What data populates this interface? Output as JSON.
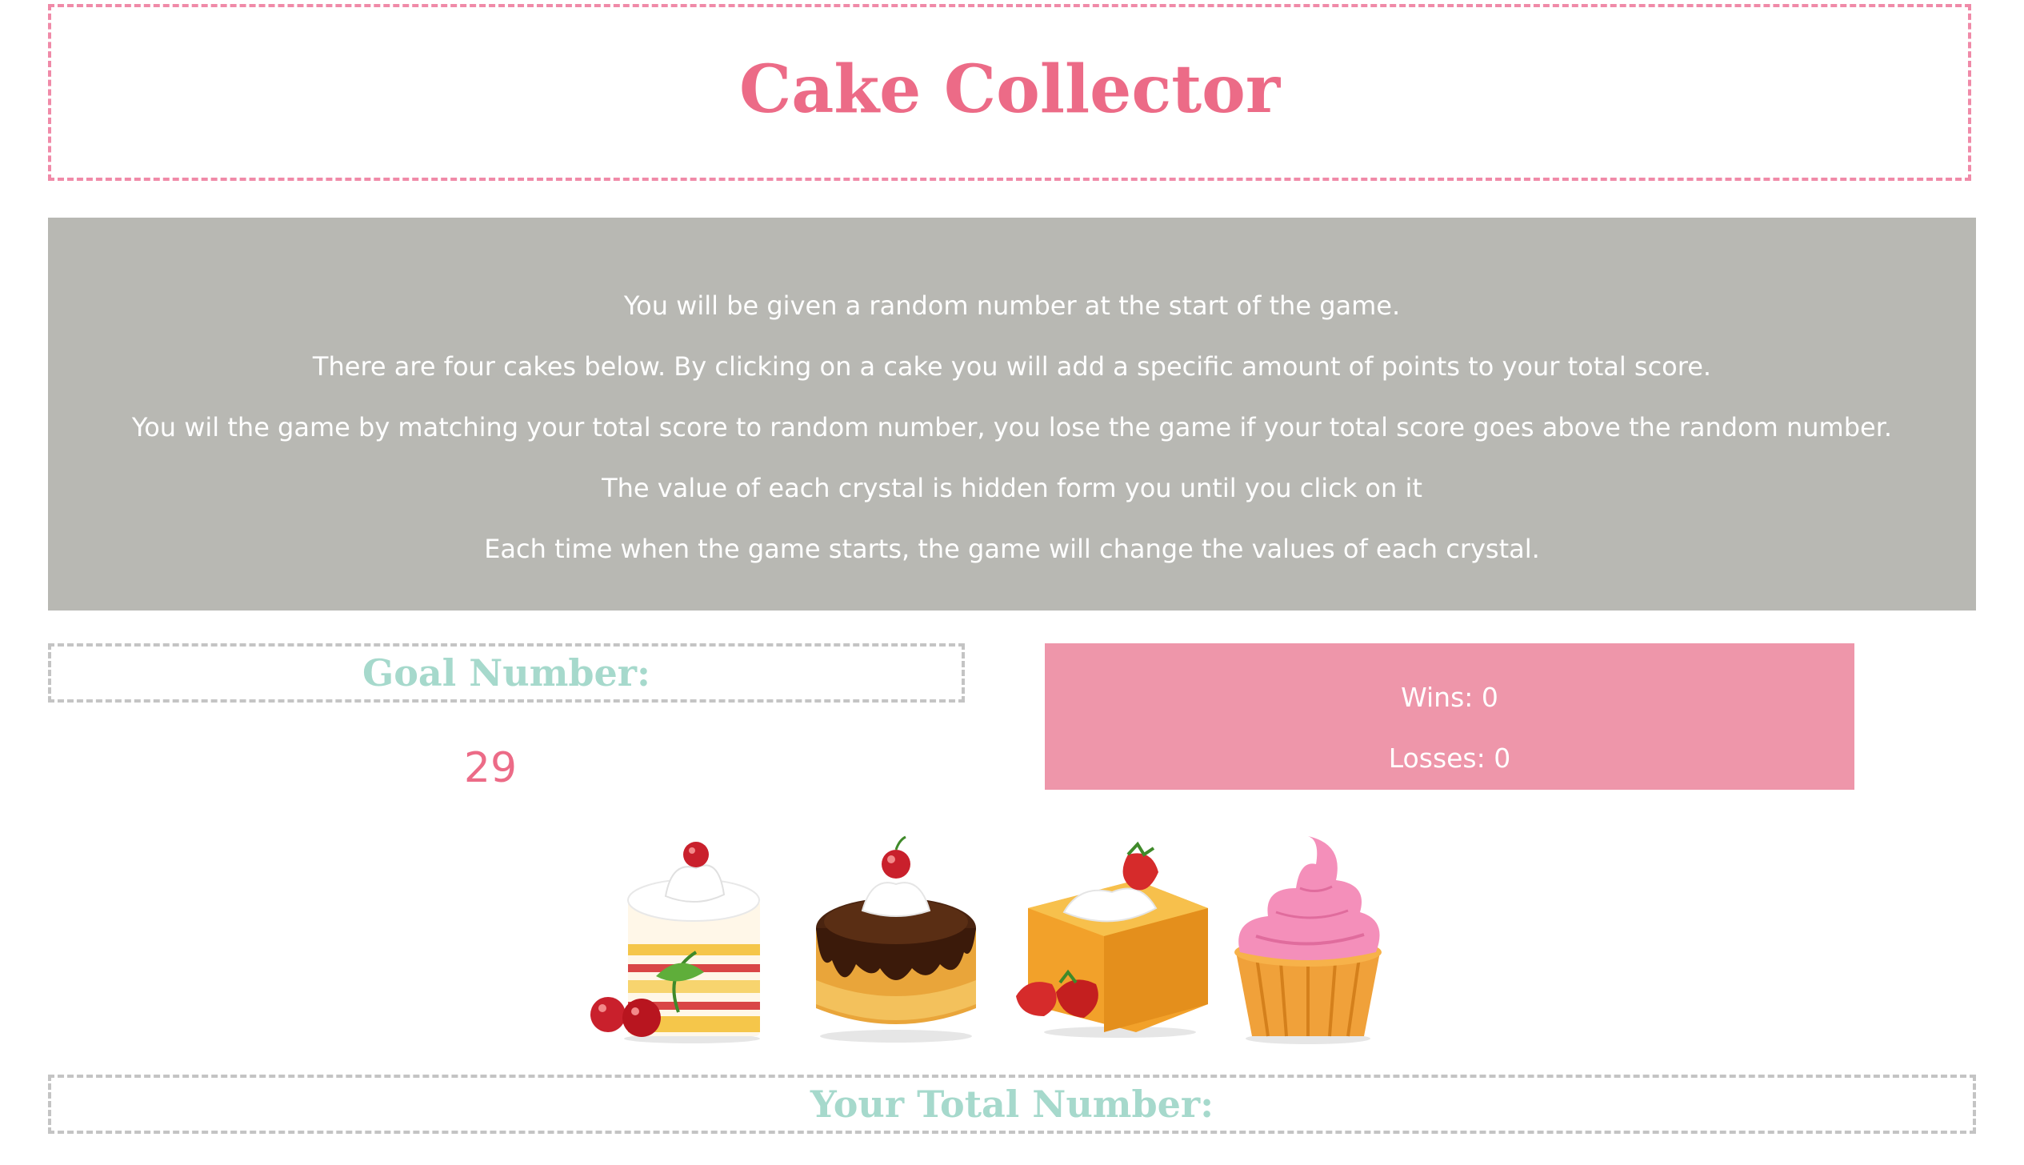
{
  "header": {
    "title": "Cake Collector"
  },
  "instructions": [
    "You will be given a random number at the start of the game.",
    "There are four cakes below. By clicking on a cake you will add a specific amount of points to your total score.",
    "You wil the game by matching your total score to random number, you lose the game if your total score goes above the random number.",
    "The value of each crystal is hidden form you until you click on it",
    "Each time when the game starts, the game will change the values of each crystal."
  ],
  "goal": {
    "label": "Goal Number:",
    "value": "29"
  },
  "scoreboard": {
    "wins": "Wins: 0",
    "losses": "Losses: 0"
  },
  "cakes": [
    {
      "name": "strawberry-layer-cake-icon"
    },
    {
      "name": "chocolate-cake-icon"
    },
    {
      "name": "strawberry-shortcake-icon"
    },
    {
      "name": "cupcake-icon"
    }
  ],
  "total": {
    "label": "Your Total Number:"
  },
  "colors": {
    "title_pink": "#ec6b87",
    "teal_heading": "#a6d9cc",
    "instructions_bg": "#b8b8b3",
    "score_panel_bg": "#ee96aa"
  }
}
